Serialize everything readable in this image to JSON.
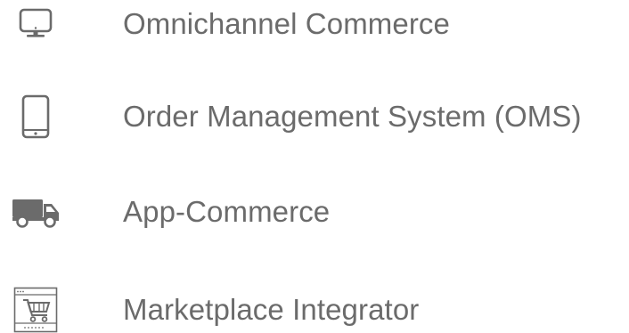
{
  "items": [
    {
      "icon": "monitor-icon",
      "label": "Omnichannel Commerce"
    },
    {
      "icon": "tablet-icon",
      "label": "Order Management System (OMS)"
    },
    {
      "icon": "delivery-truck-icon",
      "label": "App-Commerce"
    },
    {
      "icon": "shopping-cart-icon",
      "label": "Marketplace Integrator"
    }
  ],
  "colors": {
    "icon": "#6b6b6b",
    "text": "#6b6b6b",
    "background": "#ffffff"
  }
}
